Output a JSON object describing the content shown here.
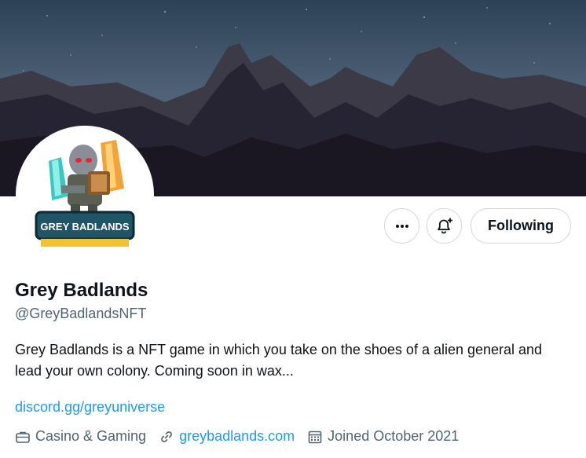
{
  "profile": {
    "display_name": "Grey Badlands",
    "handle": "@GreyBadlandsNFT",
    "bio": "Grey Badlands is a NFT game in which you take on the shoes of a alien general and lead your own colony. Coming soon in wax...",
    "bio_link": "discord.gg/greyuniverse",
    "avatar_logo_text": "GREY BADLANDS"
  },
  "actions": {
    "following_label": "Following",
    "more_icon": "more-icon",
    "notify_icon": "bell-plus-icon"
  },
  "meta": {
    "category": "Casino & Gaming",
    "website": "greybadlands.com",
    "joined": "Joined October 2021"
  },
  "colors": {
    "link": "#1d9bf0",
    "secondary_text": "#536471",
    "border": "#cfd9de"
  }
}
